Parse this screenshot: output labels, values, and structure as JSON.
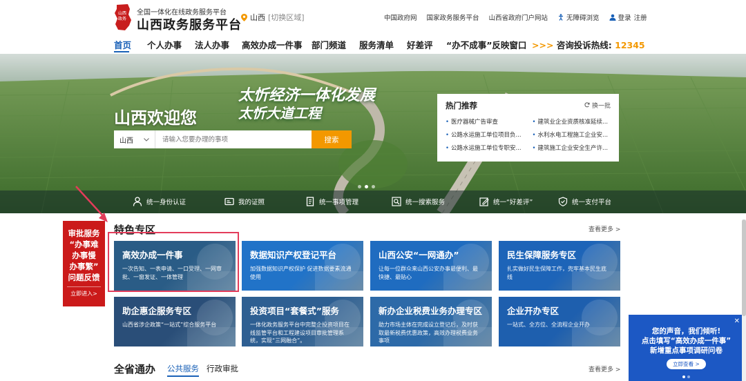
{
  "header": {
    "top_line": "全国一体化在线政务服务平台",
    "title": "山西政务服务平台",
    "location": "山西",
    "switch": "[切换区域]",
    "links": [
      "中国政府网",
      "国家政务服务平台",
      "山西省政府门户网站",
      "无障碍浏览",
      "登录",
      "注册"
    ]
  },
  "nav": {
    "items": [
      "首页",
      "个人办事",
      "法人办事",
      "高效办成一件事",
      "部门频道",
      "服务清单",
      "好差评",
      "“办不成事”反映窗口"
    ],
    "hotline_label": "咨询投诉热线:",
    "hotline_number": "12345",
    "hotline_arrow": ">>>"
  },
  "hero": {
    "welcome": "山西欢迎您",
    "slogan1": "太忻经济一体化发展",
    "slogan2": "太忻大道工程",
    "search_region": "山西",
    "search_placeholder": "请输入您要办理的事项",
    "search_button": "搜索"
  },
  "hot": {
    "title": "热门推荐",
    "change": "换一批",
    "items": [
      "医疗器械广告审查",
      "建筑业企业资质核准延续...",
      "公路水运施工单位项目负...",
      "水利水电工程施工企业安...",
      "公路水运施工单位专职安...",
      "建筑施工企业安全生产许..."
    ]
  },
  "quick": [
    "统一身份认证",
    "我的证照",
    "统一事项管理",
    "统一搜索服务",
    "统一“好差评”",
    "统一支付平台"
  ],
  "feature": {
    "title": "特色专区",
    "more": "查看更多 >",
    "cards": [
      {
        "title": "高效办成一件事",
        "desc": "一次告知、一表申请、一口受理、一网审批、一窗发证、一体管理",
        "color": "#2a5c86"
      },
      {
        "title": "数据知识产权登记平台",
        "desc": "加强数据知识产权保护 促进数据要素流通使用",
        "color": "#2173c8"
      },
      {
        "title": "山西公安“一网通办”",
        "desc": "让每一位群众来山西公安办事最便利、最快捷、最贴心",
        "color": "#1f6cc0"
      },
      {
        "title": "民生保障服务专区",
        "desc": "扎实做好民生保障工作，兜牢基本民生底线",
        "color": "#1d64b8"
      },
      {
        "title": "助企惠企服务专区",
        "desc": "山西省涉企政策“一站式”综合服务平台",
        "color": "#2a4e78"
      },
      {
        "title": "投资项目“套餐式”服务",
        "desc": "一体化政务服务平台中完整企投资项目在线监管平台和工程建设项目审批管理系统，实现“三网融合”。",
        "color": "#2e5f92"
      },
      {
        "title": "新办企业税费业务办理专区",
        "desc": "助力市场主体在完成设立登记后，及时获取最新税费优惠政策，高效办理税费业务事项",
        "color": "#2d6aa8"
      },
      {
        "title": "企业开办专区",
        "desc": "一站式、全方位、全流程企业开办",
        "color": "#1e5fae"
      }
    ]
  },
  "feedback": {
    "lines": [
      "审批服务",
      "“办事难",
      "办事慢",
      "办事繁”",
      "问题反馈"
    ],
    "go": "立即进入>"
  },
  "province": {
    "title": "全省通办",
    "tabs": [
      "公共服务",
      "行政审批"
    ],
    "more": "查看更多 >"
  },
  "survey": {
    "lines": [
      "您的声音，我们倾听!",
      "点击填写“高效办成一件事”",
      "新增重点事项调研问卷"
    ],
    "button": "立即查看 >",
    "close": "✕"
  }
}
